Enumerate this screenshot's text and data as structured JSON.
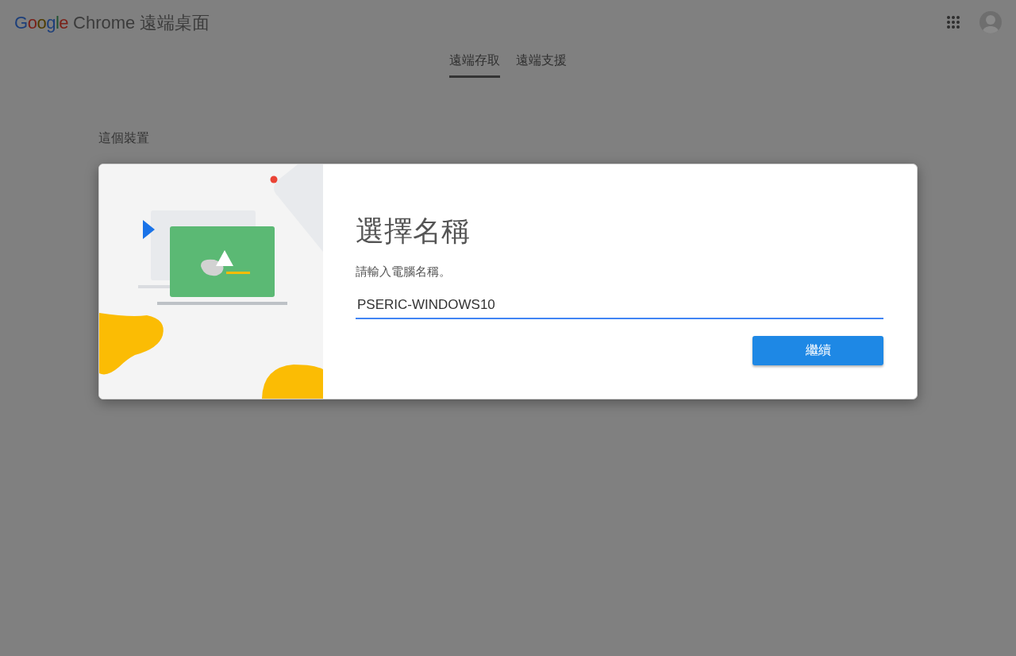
{
  "header": {
    "logo_word": "Google",
    "product": "Chrome 遠端桌面"
  },
  "tabs": [
    {
      "label": "遠端存取",
      "selected": true
    },
    {
      "label": "遠端支援",
      "selected": false
    }
  ],
  "section_title": "這個裝置",
  "dialog": {
    "title": "選擇名稱",
    "prompt": "請輸入電腦名稱。",
    "name_value": "PSERIC-WINDOWS10",
    "button": "繼續"
  }
}
